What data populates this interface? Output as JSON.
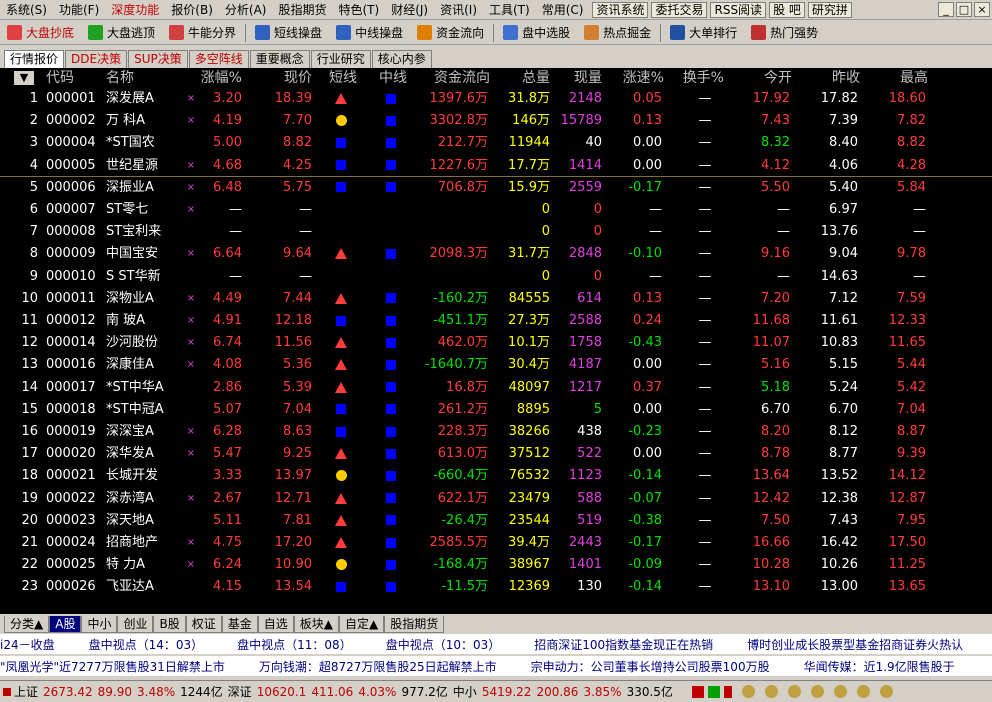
{
  "menu": [
    "系统(S)",
    "功能(F)",
    "深度功能",
    "报价(B)",
    "分析(A)",
    "股指期货",
    "特色(T)",
    "财经(J)",
    "资讯(I)",
    "工具(T)",
    "常用(C)"
  ],
  "menu_buttons": [
    "资讯系统",
    "委托交易",
    "RSS阅读",
    "股     吧",
    "研究拼"
  ],
  "toolbar": [
    {
      "label": "大盘抄底",
      "color": "#c00000",
      "icon": "trend-up-icon"
    },
    {
      "label": "大盘逃顶",
      "color": "#000000",
      "icon": "trend-down-icon"
    },
    {
      "label": "牛能分界",
      "color": "#000000",
      "icon": "bull-icon"
    },
    {
      "label": "短线操盘",
      "color": "#000000",
      "icon": "bar-icon"
    },
    {
      "label": "中线操盘",
      "color": "#000000",
      "icon": "bar2-icon"
    },
    {
      "label": "资金流向",
      "color": "#000000",
      "icon": "pie-icon"
    },
    {
      "label": "盘中选股",
      "color": "#000000",
      "icon": "screen-icon"
    },
    {
      "label": "热点掘金",
      "color": "#000000",
      "icon": "gear-icon"
    },
    {
      "label": "大单排行",
      "color": "#000000",
      "icon": "monitor-icon"
    },
    {
      "label": "热门强势",
      "color": "#000000",
      "icon": "flag-icon"
    }
  ],
  "tabs": [
    "行情报价",
    "DDE决策",
    "SUP决策",
    "多空阵线",
    "重要概念",
    "行业研究",
    "核心内参"
  ],
  "headers": [
    "代码",
    "名称",
    "涨幅%",
    "现价",
    "短线",
    "中线",
    "资金流向",
    "总量",
    "现量",
    "涨速%",
    "换手%",
    "今开",
    "昨收",
    "最高"
  ],
  "header_arrow": "▼",
  "colors": {
    "red": "#ff3c3c",
    "green": "#00e000",
    "yellow": "#ffff00",
    "purple": "#e040e0",
    "white": "#ffffff",
    "blue": "#0000ff",
    "orange": "#ffcc00"
  },
  "rows": [
    {
      "n": "1",
      "code": "000001",
      "name": "深发展A",
      "x": "×",
      "chg": "3.20",
      "price": "18.39",
      "s": "tri",
      "m": "sq",
      "flow": "1397.6万",
      "vol": "31.8万",
      "cur": "2148",
      "spd": "0.05",
      "turn": "—",
      "open": "17.92",
      "prev": "17.82",
      "high": "18.60",
      "cc": "red",
      "oc": "red",
      "hc": "red",
      "sc": "red",
      "fc": "red"
    },
    {
      "n": "2",
      "code": "000002",
      "name": "万  科A",
      "x": "×",
      "chg": "4.19",
      "price": "7.70",
      "s": "dot",
      "m": "sq",
      "flow": "3302.8万",
      "vol": "146万",
      "cur": "15789",
      "spd": "0.13",
      "turn": "—",
      "open": "7.43",
      "prev": "7.39",
      "high": "7.82",
      "cc": "red",
      "oc": "red",
      "hc": "red",
      "sc": "red",
      "fc": "red"
    },
    {
      "n": "3",
      "code": "000004",
      "name": "*ST国农",
      "x": "",
      "chg": "5.00",
      "price": "8.82",
      "s": "sq",
      "m": "sq",
      "flow": "212.7万",
      "vol": "11944",
      "cur": "40",
      "spd": "0.00",
      "turn": "—",
      "open": "8.32",
      "prev": "8.40",
      "high": "8.82",
      "cc": "red",
      "oc": "green",
      "hc": "red",
      "sc": "white",
      "fc": "red",
      "curc": "white"
    },
    {
      "n": "4",
      "code": "000005",
      "name": "世纪星源",
      "x": "×",
      "chg": "4.68",
      "price": "4.25",
      "s": "sq",
      "m": "sq",
      "flow": "1227.6万",
      "vol": "17.7万",
      "cur": "1414",
      "spd": "0.00",
      "turn": "—",
      "open": "4.12",
      "prev": "4.06",
      "high": "4.28",
      "cc": "red",
      "oc": "red",
      "hc": "red",
      "sc": "white",
      "fc": "red"
    },
    {
      "n": "5",
      "code": "000006",
      "name": "深振业A",
      "x": "×",
      "chg": "6.48",
      "price": "5.75",
      "s": "sq",
      "m": "sq",
      "flow": "706.8万",
      "vol": "15.9万",
      "cur": "2559",
      "spd": "-0.17",
      "turn": "—",
      "open": "5.50",
      "prev": "5.40",
      "high": "5.84",
      "cc": "red",
      "oc": "red",
      "hc": "red",
      "sc": "green",
      "fc": "red"
    },
    {
      "n": "6",
      "code": "000007",
      "name": "ST零七",
      "x": "×",
      "chg": "—",
      "price": "—",
      "s": "",
      "m": "",
      "flow": "",
      "vol": "0",
      "cur": "0",
      "spd": "—",
      "turn": "—",
      "open": "—",
      "prev": "6.97",
      "high": "—",
      "cc": "white",
      "oc": "white",
      "hc": "white",
      "sc": "white",
      "fc": "red",
      "curc": "red"
    },
    {
      "n": "7",
      "code": "000008",
      "name": "ST宝利来",
      "x": "",
      "chg": "—",
      "price": "—",
      "s": "",
      "m": "",
      "flow": "",
      "vol": "0",
      "cur": "0",
      "spd": "—",
      "turn": "—",
      "open": "—",
      "prev": "13.76",
      "high": "—",
      "cc": "white",
      "oc": "white",
      "hc": "white",
      "sc": "white",
      "fc": "red",
      "curc": "red"
    },
    {
      "n": "8",
      "code": "000009",
      "name": "中国宝安",
      "x": "×",
      "chg": "6.64",
      "price": "9.64",
      "s": "tri",
      "m": "sq",
      "flow": "2098.3万",
      "vol": "31.7万",
      "cur": "2848",
      "spd": "-0.10",
      "turn": "—",
      "open": "9.16",
      "prev": "9.04",
      "high": "9.78",
      "cc": "red",
      "oc": "red",
      "hc": "red",
      "sc": "green",
      "fc": "red"
    },
    {
      "n": "9",
      "code": "000010",
      "name": "S ST华新",
      "x": "",
      "chg": "—",
      "price": "—",
      "s": "",
      "m": "",
      "flow": "",
      "vol": "0",
      "cur": "0",
      "spd": "—",
      "turn": "—",
      "open": "—",
      "prev": "14.63",
      "high": "—",
      "cc": "white",
      "oc": "white",
      "hc": "white",
      "sc": "white",
      "fc": "red",
      "curc": "red"
    },
    {
      "n": "10",
      "code": "000011",
      "name": "深物业A",
      "x": "×",
      "chg": "4.49",
      "price": "7.44",
      "s": "tri",
      "m": "sq",
      "flow": "-160.2万",
      "vol": "84555",
      "cur": "614",
      "spd": "0.13",
      "turn": "—",
      "open": "7.20",
      "prev": "7.12",
      "high": "7.59",
      "cc": "red",
      "oc": "red",
      "hc": "red",
      "sc": "red",
      "fc": "green"
    },
    {
      "n": "11",
      "code": "000012",
      "name": "南  玻A",
      "x": "×",
      "chg": "4.91",
      "price": "12.18",
      "s": "sq",
      "m": "sq",
      "flow": "-451.1万",
      "vol": "27.3万",
      "cur": "2588",
      "spd": "0.24",
      "turn": "—",
      "open": "11.68",
      "prev": "11.61",
      "high": "12.33",
      "cc": "red",
      "oc": "red",
      "hc": "red",
      "sc": "red",
      "fc": "green"
    },
    {
      "n": "12",
      "code": "000014",
      "name": "沙河股份",
      "x": "×",
      "chg": "6.74",
      "price": "11.56",
      "s": "tri",
      "m": "sq",
      "flow": "462.0万",
      "vol": "10.1万",
      "cur": "1758",
      "spd": "-0.43",
      "turn": "—",
      "open": "11.07",
      "prev": "10.83",
      "high": "11.65",
      "cc": "red",
      "oc": "red",
      "hc": "red",
      "sc": "green",
      "fc": "red"
    },
    {
      "n": "13",
      "code": "000016",
      "name": "深康佳A",
      "x": "×",
      "chg": "4.08",
      "price": "5.36",
      "s": "tri",
      "m": "sq",
      "flow": "-1640.7万",
      "vol": "30.4万",
      "cur": "4187",
      "spd": "0.00",
      "turn": "—",
      "open": "5.16",
      "prev": "5.15",
      "high": "5.44",
      "cc": "red",
      "oc": "red",
      "hc": "red",
      "sc": "white",
      "fc": "green"
    },
    {
      "n": "14",
      "code": "000017",
      "name": "*ST中华A",
      "x": "",
      "chg": "2.86",
      "price": "5.39",
      "s": "tri",
      "m": "sq",
      "flow": "16.8万",
      "vol": "48097",
      "cur": "1217",
      "spd": "0.37",
      "turn": "—",
      "open": "5.18",
      "prev": "5.24",
      "high": "5.42",
      "cc": "red",
      "oc": "green",
      "hc": "red",
      "sc": "red",
      "fc": "red"
    },
    {
      "n": "15",
      "code": "000018",
      "name": "*ST中冠A",
      "x": "",
      "chg": "5.07",
      "price": "7.04",
      "s": "sq",
      "m": "sq",
      "flow": "261.2万",
      "vol": "8895",
      "cur": "5",
      "spd": "0.00",
      "turn": "—",
      "open": "6.70",
      "prev": "6.70",
      "high": "7.04",
      "cc": "red",
      "oc": "white",
      "hc": "red",
      "sc": "white",
      "fc": "red",
      "curc": "green"
    },
    {
      "n": "16",
      "code": "000019",
      "name": "深深宝A",
      "x": "×",
      "chg": "6.28",
      "price": "8.63",
      "s": "sq",
      "m": "sq",
      "flow": "228.3万",
      "vol": "38266",
      "cur": "438",
      "spd": "-0.23",
      "turn": "—",
      "open": "8.20",
      "prev": "8.12",
      "high": "8.87",
      "cc": "red",
      "oc": "red",
      "hc": "red",
      "sc": "green",
      "fc": "red",
      "curc": "white"
    },
    {
      "n": "17",
      "code": "000020",
      "name": "深华发A",
      "x": "×",
      "chg": "5.47",
      "price": "9.25",
      "s": "tri",
      "m": "sq",
      "flow": "613.0万",
      "vol": "37512",
      "cur": "522",
      "spd": "0.00",
      "turn": "—",
      "open": "8.78",
      "prev": "8.77",
      "high": "9.39",
      "cc": "red",
      "oc": "red",
      "hc": "red",
      "sc": "white",
      "fc": "red"
    },
    {
      "n": "18",
      "code": "000021",
      "name": "长城开发",
      "x": "",
      "chg": "3.33",
      "price": "13.97",
      "s": "dot",
      "m": "sq",
      "flow": "-660.4万",
      "vol": "76532",
      "cur": "1123",
      "spd": "-0.14",
      "turn": "—",
      "open": "13.64",
      "prev": "13.52",
      "high": "14.12",
      "cc": "red",
      "oc": "red",
      "hc": "red",
      "sc": "green",
      "fc": "green"
    },
    {
      "n": "19",
      "code": "000022",
      "name": "深赤湾A",
      "x": "×",
      "chg": "2.67",
      "price": "12.71",
      "s": "tri",
      "m": "sq",
      "flow": "622.1万",
      "vol": "23479",
      "cur": "588",
      "spd": "-0.07",
      "turn": "—",
      "open": "12.42",
      "prev": "12.38",
      "high": "12.87",
      "cc": "red",
      "oc": "red",
      "hc": "red",
      "sc": "green",
      "fc": "red"
    },
    {
      "n": "20",
      "code": "000023",
      "name": "深天地A",
      "x": "",
      "chg": "5.11",
      "price": "7.81",
      "s": "tri",
      "m": "sq",
      "flow": "-26.4万",
      "vol": "23544",
      "cur": "519",
      "spd": "-0.38",
      "turn": "—",
      "open": "7.50",
      "prev": "7.43",
      "high": "7.95",
      "cc": "red",
      "oc": "red",
      "hc": "red",
      "sc": "green",
      "fc": "green"
    },
    {
      "n": "21",
      "code": "000024",
      "name": "招商地产",
      "x": "×",
      "chg": "4.75",
      "price": "17.20",
      "s": "tri",
      "m": "sq",
      "flow": "2585.5万",
      "vol": "39.4万",
      "cur": "2443",
      "spd": "-0.17",
      "turn": "—",
      "open": "16.66",
      "prev": "16.42",
      "high": "17.50",
      "cc": "red",
      "oc": "red",
      "hc": "red",
      "sc": "green",
      "fc": "red"
    },
    {
      "n": "22",
      "code": "000025",
      "name": "特  力A",
      "x": "×",
      "chg": "6.24",
      "price": "10.90",
      "s": "dot",
      "m": "sq",
      "flow": "-168.4万",
      "vol": "38967",
      "cur": "1401",
      "spd": "-0.09",
      "turn": "—",
      "open": "10.28",
      "prev": "10.26",
      "high": "11.25",
      "cc": "red",
      "oc": "red",
      "hc": "red",
      "sc": "green",
      "fc": "green"
    },
    {
      "n": "23",
      "code": "000026",
      "name": "飞亚达A",
      "x": "",
      "chg": "4.15",
      "price": "13.54",
      "s": "sq",
      "m": "sq",
      "flow": "-11.5万",
      "vol": "12369",
      "cur": "130",
      "spd": "-0.14",
      "turn": "—",
      "open": "13.10",
      "prev": "13.00",
      "high": "13.65",
      "cc": "red",
      "oc": "red",
      "hc": "red",
      "sc": "green",
      "fc": "green",
      "curc": "white"
    }
  ],
  "bottom_tabs": [
    "分类▲",
    "A股",
    "中小",
    "创业",
    "B股",
    "权证",
    "基金",
    "自选",
    "板块▲",
    "自定▲",
    "股指期货"
  ],
  "news1": [
    "i24－收盘",
    "盘中视点（14：03）",
    "盘中视点（11：08）",
    "盘中视点（10：03）",
    "招商深证100指数基金现正在热销",
    "博时创业成长股票型基金招商证券火热认"
  ],
  "news2": [
    "\"凤凰光学\"近7277万限售股31日解禁上市",
    "万向钱潮：超8727万限售股25日起解禁上市",
    "宗申动力：公司董事长增持公司股票100万股",
    "华闻传媒：近1.9亿限售股于"
  ],
  "status": {
    "sh_label": "上证",
    "sh_val": "2673.42",
    "sh_chg": "89.90",
    "sh_pct": "3.48%",
    "sh_amt": "1244亿",
    "sz_label": "深证",
    "sz_val": "10620.1",
    "sz_chg": "411.06",
    "sz_pct": "4.03%",
    "sz_amt": "977.2亿",
    "zx_label": "中小",
    "zx_val": "5419.22",
    "zx_chg": "200.86",
    "zx_pct": "3.85%",
    "zx_amt": "330.5亿"
  }
}
